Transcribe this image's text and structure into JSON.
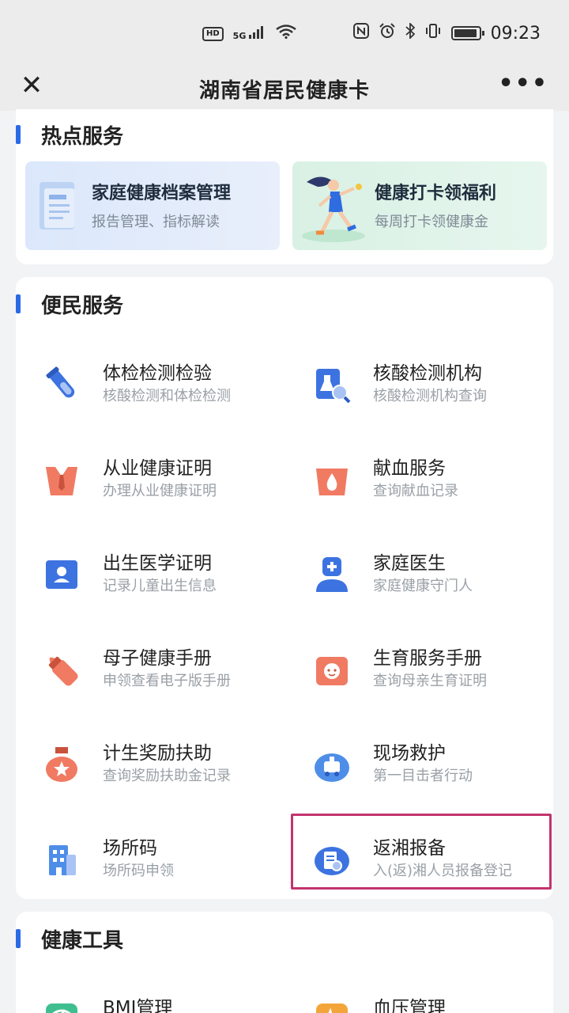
{
  "status": {
    "time": "09:23",
    "hd": "HD",
    "net": "5G"
  },
  "nav": {
    "title": "湖南省居民健康卡",
    "close": "✕",
    "more": "•••"
  },
  "hot": {
    "title": "热点服务",
    "items": [
      {
        "title": "家庭健康档案管理",
        "sub": "报告管理、指标解读"
      },
      {
        "title": "健康打卡领福利",
        "sub": "每周打卡领健康金"
      }
    ]
  },
  "life": {
    "title": "便民服务",
    "items": [
      {
        "title": "体检检测检验",
        "sub": "核酸检测和体检检测",
        "icon": "test-tube-icon"
      },
      {
        "title": "核酸检测机构",
        "sub": "核酸检测机构查询",
        "icon": "lab-search-icon"
      },
      {
        "title": "从业健康证明",
        "sub": "办理从业健康证明",
        "icon": "worker-certificate-icon"
      },
      {
        "title": "献血服务",
        "sub": "查询献血记录",
        "icon": "blood-drop-icon"
      },
      {
        "title": "出生医学证明",
        "sub": "记录儿童出生信息",
        "icon": "id-card-icon"
      },
      {
        "title": "家庭医生",
        "sub": "家庭健康守门人",
        "icon": "doctor-icon"
      },
      {
        "title": "母子健康手册",
        "sub": "申领查看电子版手册",
        "icon": "baby-bottle-icon"
      },
      {
        "title": "生育服务手册",
        "sub": "查询母亲生育证明",
        "icon": "baby-face-icon"
      },
      {
        "title": "计生奖励扶助",
        "sub": "查询奖励扶助金记录",
        "icon": "medal-icon"
      },
      {
        "title": "现场救护",
        "sub": "第一目击者行动",
        "icon": "ambulance-icon"
      },
      {
        "title": "场所码",
        "sub": "场所码申领",
        "icon": "building-icon"
      },
      {
        "title": "返湘报备",
        "sub": "入(返)湘人员报备登记",
        "icon": "report-icon"
      }
    ]
  },
  "tools": {
    "title": "健康工具",
    "items": [
      {
        "title": "BMI管理",
        "icon": "bmi-scale-icon"
      },
      {
        "title": "血压管理",
        "icon": "blood-pressure-icon"
      }
    ]
  },
  "colors": {
    "accent": "#2b6ae6",
    "highlight": "#c4336e",
    "coral": "#f07a62",
    "blue": "#3d73e0"
  }
}
